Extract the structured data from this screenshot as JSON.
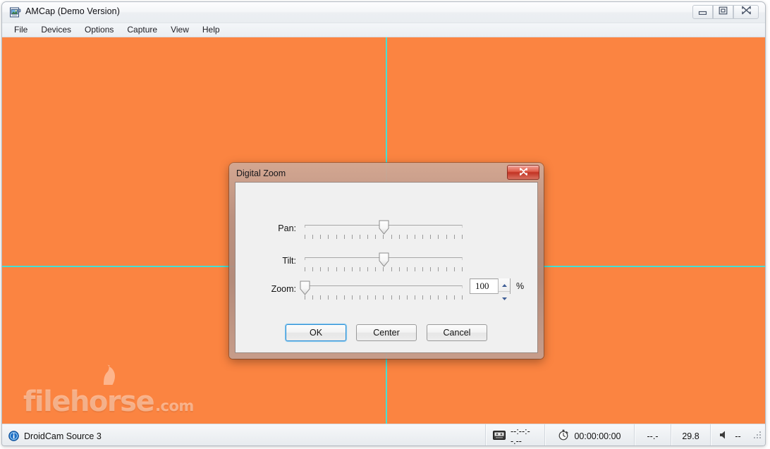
{
  "window": {
    "title": "AMCap (Demo Version)",
    "icon": "camera-capture-icon",
    "caption_buttons": {
      "minimize": "minimize-icon",
      "maximize": "maximize-icon",
      "close": "close-icon"
    }
  },
  "menubar": {
    "items": [
      {
        "label": "File"
      },
      {
        "label": "Devices"
      },
      {
        "label": "Options"
      },
      {
        "label": "Capture"
      },
      {
        "label": "View"
      },
      {
        "label": "Help"
      }
    ]
  },
  "video": {
    "background_color": "#fb8441",
    "crosshair_color": "#44e0d4",
    "watermark": {
      "text_main": "filehorse",
      "text_suffix": ".com"
    }
  },
  "dialog": {
    "title": "Digital Zoom",
    "close_label": "✕",
    "controls": [
      {
        "label": "Pan:",
        "value_percent": 50,
        "ticks": 21
      },
      {
        "label": "Tilt:",
        "value_percent": 50,
        "ticks": 21
      },
      {
        "label": "Zoom:",
        "value_percent": 0,
        "ticks": 21
      }
    ],
    "zoom_field": {
      "value": "100",
      "unit": "%",
      "placeholder": "100"
    },
    "buttons": [
      {
        "label": "OK",
        "focused": true
      },
      {
        "label": "Center",
        "focused": false
      },
      {
        "label": "Cancel",
        "focused": false
      }
    ]
  },
  "statusbar": {
    "device": "DroidCam Source 3",
    "tape_time": "--:--:--.--",
    "elapsed_time": "00:00:00:00",
    "rate": "--.-",
    "fps": "29.8",
    "volume": "--"
  }
}
